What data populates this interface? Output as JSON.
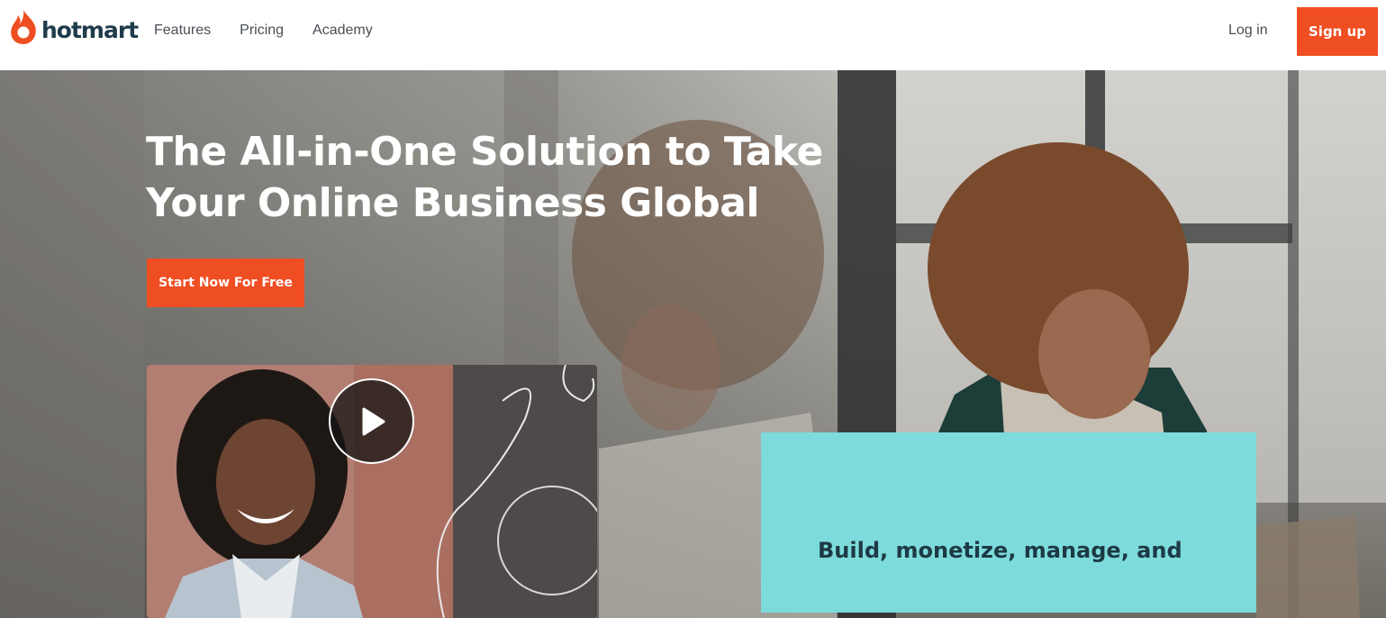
{
  "header": {
    "logo_text": "hotmart",
    "nav": [
      "Features",
      "Pricing",
      "Academy"
    ],
    "login_label": "Log in",
    "signup_label": "Sign up"
  },
  "hero": {
    "title_line1": "The All-in-One Solution to Take",
    "title_line2": "Your Online Business Global",
    "cta_label": "Start Now For Free",
    "card_text": "Build, monetize, manage, and"
  },
  "colors": {
    "brand": "#ef4e23",
    "teal": "#7ddbdb",
    "text_dark": "#1f3b4a"
  },
  "icons": {
    "logo": "flame-icon",
    "video": "play-icon"
  }
}
